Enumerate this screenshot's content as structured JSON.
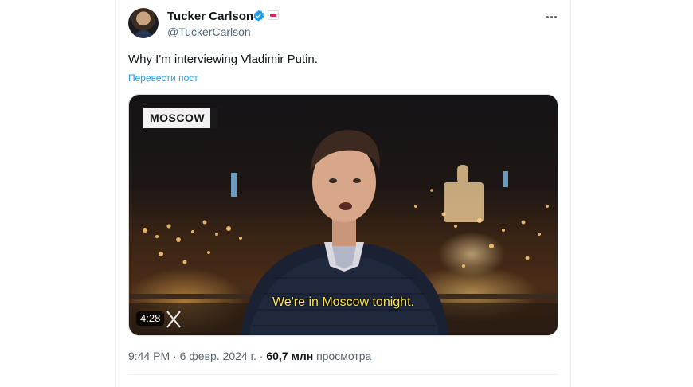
{
  "author": {
    "name": "Tucker Carlson",
    "handle": "@TuckerCarlson"
  },
  "tweet": {
    "text": "Why I'm interviewing Vladimir Putin.",
    "translate_label": "Перевести пост"
  },
  "video": {
    "location_label": "MOSCOW",
    "subtitle": "We're in Moscow tonight.",
    "duration": "4:28"
  },
  "meta": {
    "time": "9:44 PM",
    "separator1": " · ",
    "date": "6 февр. 2024 г.",
    "separator2": " · ",
    "views_count": "60,7 млн",
    "views_label": "просмотра"
  },
  "colors": {
    "link": "#1d9bf0",
    "verified": "#1d9bf0",
    "subtitle": "#ffe54a"
  },
  "icons": {
    "verified": "verified-check-icon",
    "more": "more-dots-icon",
    "badge": "affiliate-badge-icon",
    "watermark": "x-logo-icon"
  }
}
